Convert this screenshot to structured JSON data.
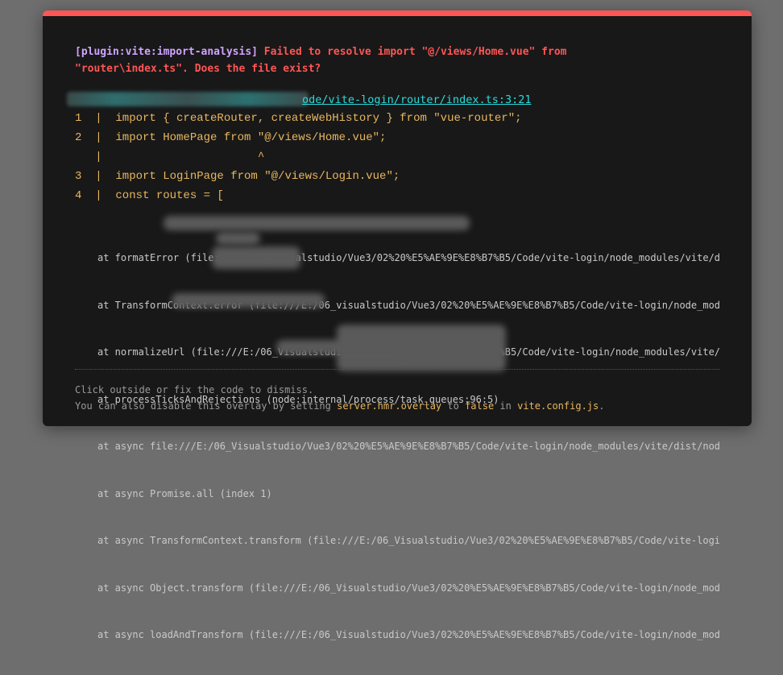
{
  "error": {
    "plugin": "[plugin:vite:import-analysis]",
    "message": " Failed to resolve import \"@/views/Home.vue\" from \"router\\index.ts\". Does the file exist?",
    "file": "ode/vite-login/router/index.ts:3:21"
  },
  "frame": "1  |  import { createRouter, createWebHistory } from \"vue-router\";\n2  |  import HomePage from \"@/views/Home.vue\";\n   |                       ^\n3  |  import LoginPage from \"@/views/Login.vue\";\n4  |  const routes = [",
  "stack": [
    "at formatError (file:///E:/06_Visualstudio/Vue3/02%20%E5%AE%9E%E8%B7%B5/Code/vite-login/node_modules/vite/di",
    "at TransformContext.error (file:///E:/06_visualstudio/Vue3/02%20%E5%AE%9E%E8%B7%B5/Code/vite-login/node_modu",
    "at normalizeUrl (file:///E:/06_Visualstudio/Vue3/02%20%E5%AE%9E%E8%B7%B5/Code/vite-login/node_modules/vite/d",
    "at processTicksAndRejections (node:internal/process/task_queues:96:5)",
    "at async file:///E:/06_Visualstudio/Vue3/02%20%E5%AE%9E%E8%B7%B5/Code/vite-login/node_modules/vite/dist/node",
    "at async Promise.all (index 1)",
    "at async TransformContext.transform (file:///E:/06_Visualstudio/Vue3/02%20%E5%AE%9E%E8%B7%B5/Code/vite-login",
    "at async Object.transform (file:///E:/06_Visualstudio/Vue3/02%20%E5%AE%9E%E8%B7%B5/Code/vite-login/node_modu",
    "at async loadAndTransform (file:///E:/06_Visualstudio/Vue3/02%20%E5%AE%9E%E8%B7%B5/Code/vite-login/node_modu"
  ],
  "tip": {
    "line1": "Click outside or fix the code to dismiss.",
    "line2_pre": "You can also disable this overlay by setting ",
    "code1": "server.hmr.overlay",
    "line2_mid": " to ",
    "code2": "false",
    "line2_mid2": " in ",
    "code3": "vite.config.js",
    "line2_end": "."
  }
}
